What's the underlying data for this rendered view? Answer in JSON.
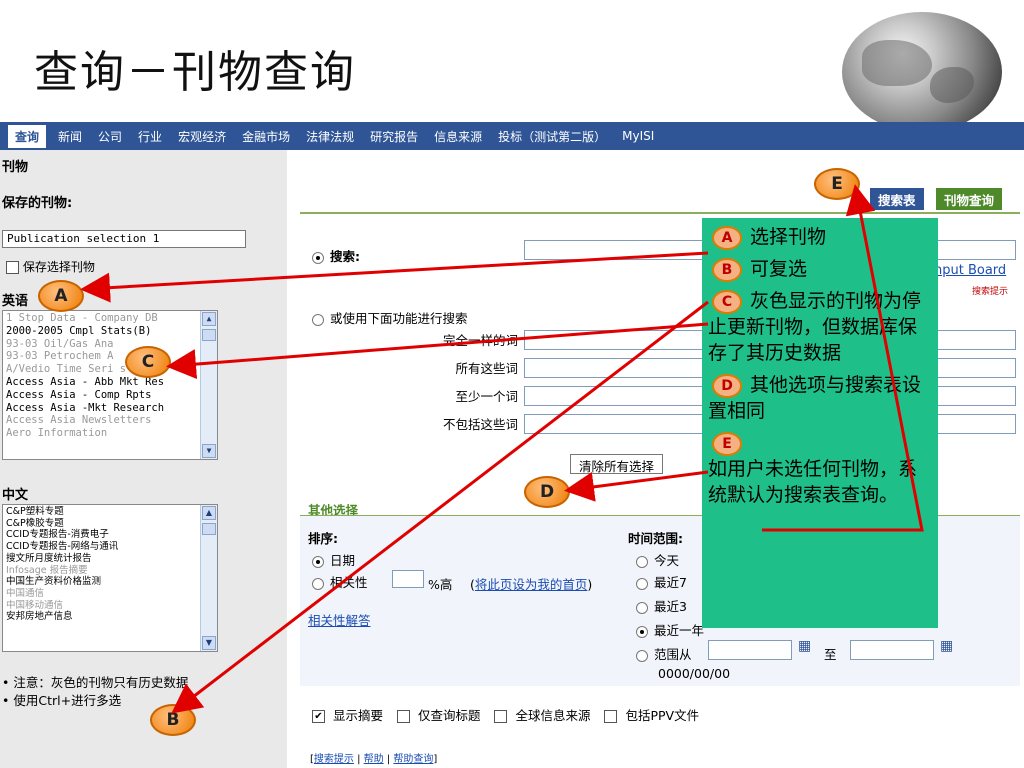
{
  "slide": {
    "title": "查询－刊物查询"
  },
  "nav": {
    "active": "查询",
    "items": [
      "新闻",
      "公司",
      "行业",
      "宏观经济",
      "金融市场",
      "法律法规",
      "研究报告",
      "信息来源",
      "投标（测试第二版）",
      "MyISI"
    ]
  },
  "left": {
    "section": "刊物",
    "saved_label": "保存的刊物:",
    "saved_value": "Publication selection 1",
    "save_checkbox": "保存选择刊物",
    "english_label": "英语",
    "english_items": [
      {
        "text": "1 Stop Data - Company DB",
        "gray": true
      },
      {
        "text": "2000-2005 Cmpl Stats(B)",
        "gray": false
      },
      {
        "text": "93-03 Oil/Gas Ana",
        "gray": true
      },
      {
        "text": "93-03 Petrochem A",
        "gray": true
      },
      {
        "text": "A/Vedio Time Seri      s",
        "gray": true
      },
      {
        "text": "Access Asia - Abb Mkt Res",
        "gray": false
      },
      {
        "text": "Access Asia - Comp Rpts",
        "gray": false
      },
      {
        "text": "Access Asia -Mkt Research",
        "gray": false
      },
      {
        "text": "Access Asia Newsletters",
        "gray": true
      },
      {
        "text": "Aero Information",
        "gray": true
      }
    ],
    "chinese_label": "中文",
    "chinese_items": [
      {
        "text": "C&P塑料专题",
        "gray": false
      },
      {
        "text": "C&P橡胶专题",
        "gray": false
      },
      {
        "text": "CCID专题报告-消费电子",
        "gray": false
      },
      {
        "text": "CCID专题报告-网络与通讯",
        "gray": false
      },
      {
        "text": "搜文所月度统计报告",
        "gray": false
      },
      {
        "text": "Infosage 报告摘要",
        "gray": true
      },
      {
        "text": "中国生产资料价格监测",
        "gray": false
      },
      {
        "text": "中国通信",
        "gray": true
      },
      {
        "text": "中国移动通信",
        "gray": true
      },
      {
        "text": "安邦房地产信息",
        "gray": false
      }
    ],
    "notes": [
      "注意：灰色的刊物只有历史数据",
      "使用Ctrl+进行多选"
    ]
  },
  "right": {
    "tabs": {
      "search_table": "搜索表",
      "publication_query": "刊物查询"
    },
    "search_label": "搜索:",
    "input_board": "nput Board",
    "search_tips_small": "搜索提示",
    "alt_search": "或使用下面功能进行搜索",
    "fields": [
      "完全一样的词",
      "所有这些词",
      "至少一个词",
      "不包括这些词"
    ],
    "clear_button": "清除所有选择",
    "other_options": "其他选择",
    "sort_label": "排序:",
    "sort_date": "日期",
    "sort_relevance": "相关性",
    "relevance_suffix": "%高",
    "set_homepage": "将此页设为我的首页",
    "related_answers": "相关性解答",
    "time_label": "时间范围:",
    "time_options": [
      "今天",
      "最近7",
      "最近3",
      "最近一年"
    ],
    "range_from": "范围从",
    "range_to": "至",
    "date_hint": "0000/00/00",
    "checks": [
      {
        "label": "显示摘要",
        "checked": true
      },
      {
        "label": "仅查询标题",
        "checked": false
      },
      {
        "label": "全球信息来源",
        "checked": false
      },
      {
        "label": "包括PPV文件",
        "checked": false
      }
    ],
    "footer_links": [
      "搜索提示",
      "帮助",
      "帮助查询"
    ]
  },
  "callout": {
    "A": "选择刊物",
    "B": "可复选",
    "C": "灰色显示的刊物为停止更新刊物，但数据库保存了其历史数据",
    "D": "其他选项与搜索表设置相同",
    "E": "如用户未选任何刊物，系统默认为搜索表查询。"
  },
  "badges": {
    "A": "A",
    "B": "B",
    "C": "C",
    "D": "D",
    "E": "E"
  },
  "colors": {
    "nav": "#2f5597",
    "tab_blue": "#2f5597",
    "tab_green": "#4f8a2a",
    "callout": "#1fbf8a",
    "arrow": "#e00000"
  }
}
